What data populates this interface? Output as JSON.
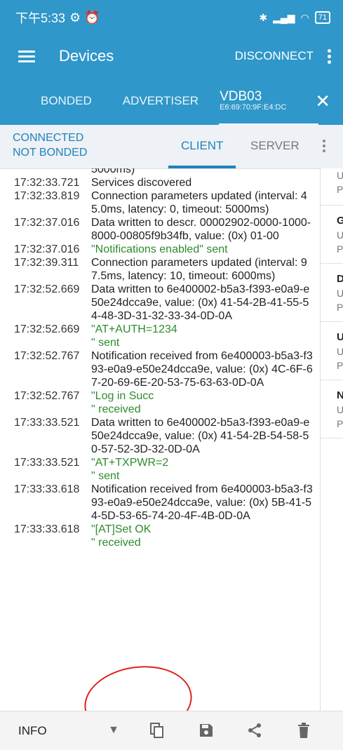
{
  "status_bar": {
    "time": "下午5:33",
    "battery": "71"
  },
  "app_bar": {
    "title": "Devices",
    "disconnect_label": "DISCONNECT"
  },
  "tabs": {
    "bonded": "BONDED",
    "advertiser": "ADVERTISER",
    "device_name": "VDB03",
    "device_mac": "E6:69:70:9F:E4:DC"
  },
  "connection": {
    "state": "CONNECTED",
    "bond": "NOT BONDED",
    "client_tab": "CLIENT",
    "server_tab": "SERVER"
  },
  "log": [
    {
      "time": "",
      "msg": "5000ms)",
      "color": "normal"
    },
    {
      "time": "17:32:33.721",
      "msg": "Services discovered",
      "color": "normal"
    },
    {
      "time": "17:32:33.819",
      "msg": "Connection parameters updated (interval: 45.0ms, latency: 0, timeout: 5000ms)",
      "color": "normal"
    },
    {
      "time": "17:32:37.016",
      "msg": "Data written to descr. 00002902-0000-1000-8000-00805f9b34fb, value: (0x) 01-00",
      "color": "normal"
    },
    {
      "time": "17:32:37.016",
      "msg": "\"Notifications enabled\" sent",
      "color": "green"
    },
    {
      "time": "17:32:39.311",
      "msg": "Connection parameters updated (interval: 97.5ms, latency: 10, timeout: 6000ms)",
      "color": "normal"
    },
    {
      "time": "17:32:52.669",
      "msg": "Data written to 6e400002-b5a3-f393-e0a9-e50e24dcca9e, value: (0x) 41-54-2B-41-55-54-48-3D-31-32-33-34-0D-0A",
      "color": "normal"
    },
    {
      "time": "17:32:52.669",
      "msg": "\"AT+AUTH=1234\n\" sent",
      "color": "green"
    },
    {
      "time": "17:32:52.767",
      "msg": "Notification received from 6e400003-b5a3-f393-e0a9-e50e24dcca9e, value: (0x) 4C-6F-67-20-69-6E-20-53-75-63-63-0D-0A",
      "color": "normal"
    },
    {
      "time": "17:32:52.767",
      "msg": "\"Log in Succ\n\" received",
      "color": "green"
    },
    {
      "time": "17:33:33.521",
      "msg": "Data written to 6e400002-b5a3-f393-e0a9-e50e24dcca9e, value: (0x) 41-54-2B-54-58-50-57-52-3D-32-0D-0A",
      "color": "normal"
    },
    {
      "time": "17:33:33.521",
      "msg": "\"AT+TXPWR=2\n\" sent",
      "color": "green"
    },
    {
      "time": "17:33:33.618",
      "msg": "Notification received from 6e400003-b5a3-f393-e0a9-e50e24dcca9e, value: (0x) 5B-41-54-5D-53-65-74-20-4F-4B-0D-0A",
      "color": "normal"
    },
    {
      "time": "17:33:33.618",
      "msg": "\"[AT]Set OK\n\" received",
      "color": "green"
    }
  ],
  "side_panel": [
    {
      "head": "",
      "lines": [
        "U",
        "P"
      ]
    },
    {
      "head": "G",
      "lines": [
        "U",
        "P"
      ]
    },
    {
      "head": "D",
      "lines": [
        "U",
        "P"
      ]
    },
    {
      "head": "U",
      "lines": [
        "U",
        "P"
      ]
    },
    {
      "head": "N",
      "lines": [
        "U",
        "P"
      ]
    }
  ],
  "bottom_bar": {
    "log_level": "INFO"
  },
  "colors": {
    "primary": "#2f97c9",
    "accent": "#1f82bb",
    "green_text": "#2e8b2e",
    "annotation": "#e02020"
  }
}
